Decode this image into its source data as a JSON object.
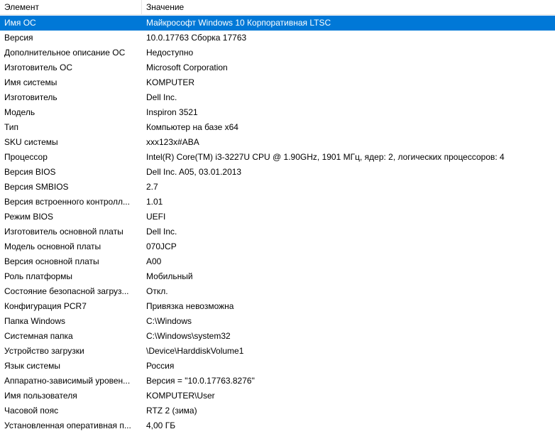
{
  "columns": {
    "element": "Элемент",
    "value": "Значение"
  },
  "selection_color": "#0078d7",
  "rows": [
    {
      "element": "Имя ОС",
      "value": "Майкрософт Windows 10 Корпоративная LTSC"
    },
    {
      "element": "Версия",
      "value": "10.0.17763 Сборка 17763"
    },
    {
      "element": "Дополнительное описание ОС",
      "value": "Недоступно"
    },
    {
      "element": "Изготовитель ОС",
      "value": "Microsoft Corporation"
    },
    {
      "element": "Имя системы",
      "value": "KOMPUTER"
    },
    {
      "element": "Изготовитель",
      "value": "Dell Inc."
    },
    {
      "element": "Модель",
      "value": "Inspiron 3521"
    },
    {
      "element": "Тип",
      "value": "Компьютер на базе x64"
    },
    {
      "element": "SKU системы",
      "value": "xxx123x#ABA"
    },
    {
      "element": "Процессор",
      "value": "Intel(R) Core(TM) i3-3227U CPU @ 1.90GHz, 1901 МГц, ядер: 2, логических процессоров: 4"
    },
    {
      "element": "Версия BIOS",
      "value": "Dell Inc. A05, 03.01.2013"
    },
    {
      "element": "Версия SMBIOS",
      "value": "2.7"
    },
    {
      "element": "Версия встроенного контролл...",
      "value": "1.01"
    },
    {
      "element": "Режим BIOS",
      "value": "UEFI"
    },
    {
      "element": "Изготовитель основной платы",
      "value": "Dell Inc."
    },
    {
      "element": "Модель основной платы",
      "value": "070JCP"
    },
    {
      "element": "Версия основной платы",
      "value": "A00"
    },
    {
      "element": "Роль платформы",
      "value": "Мобильный"
    },
    {
      "element": "Состояние безопасной загруз...",
      "value": "Откл."
    },
    {
      "element": "Конфигурация PCR7",
      "value": "Привязка невозможна"
    },
    {
      "element": "Папка Windows",
      "value": "C:\\Windows"
    },
    {
      "element": "Системная папка",
      "value": "C:\\Windows\\system32"
    },
    {
      "element": "Устройство загрузки",
      "value": "\\Device\\HarddiskVolume1"
    },
    {
      "element": "Язык системы",
      "value": "Россия"
    },
    {
      "element": "Аппаратно-зависимый уровен...",
      "value": "Версия = \"10.0.17763.8276\""
    },
    {
      "element": "Имя пользователя",
      "value": "KOMPUTER\\User"
    },
    {
      "element": "Часовой пояс",
      "value": "RTZ 2 (зима)"
    },
    {
      "element": "Установленная оперативная п...",
      "value": "4,00 ГБ"
    }
  ]
}
